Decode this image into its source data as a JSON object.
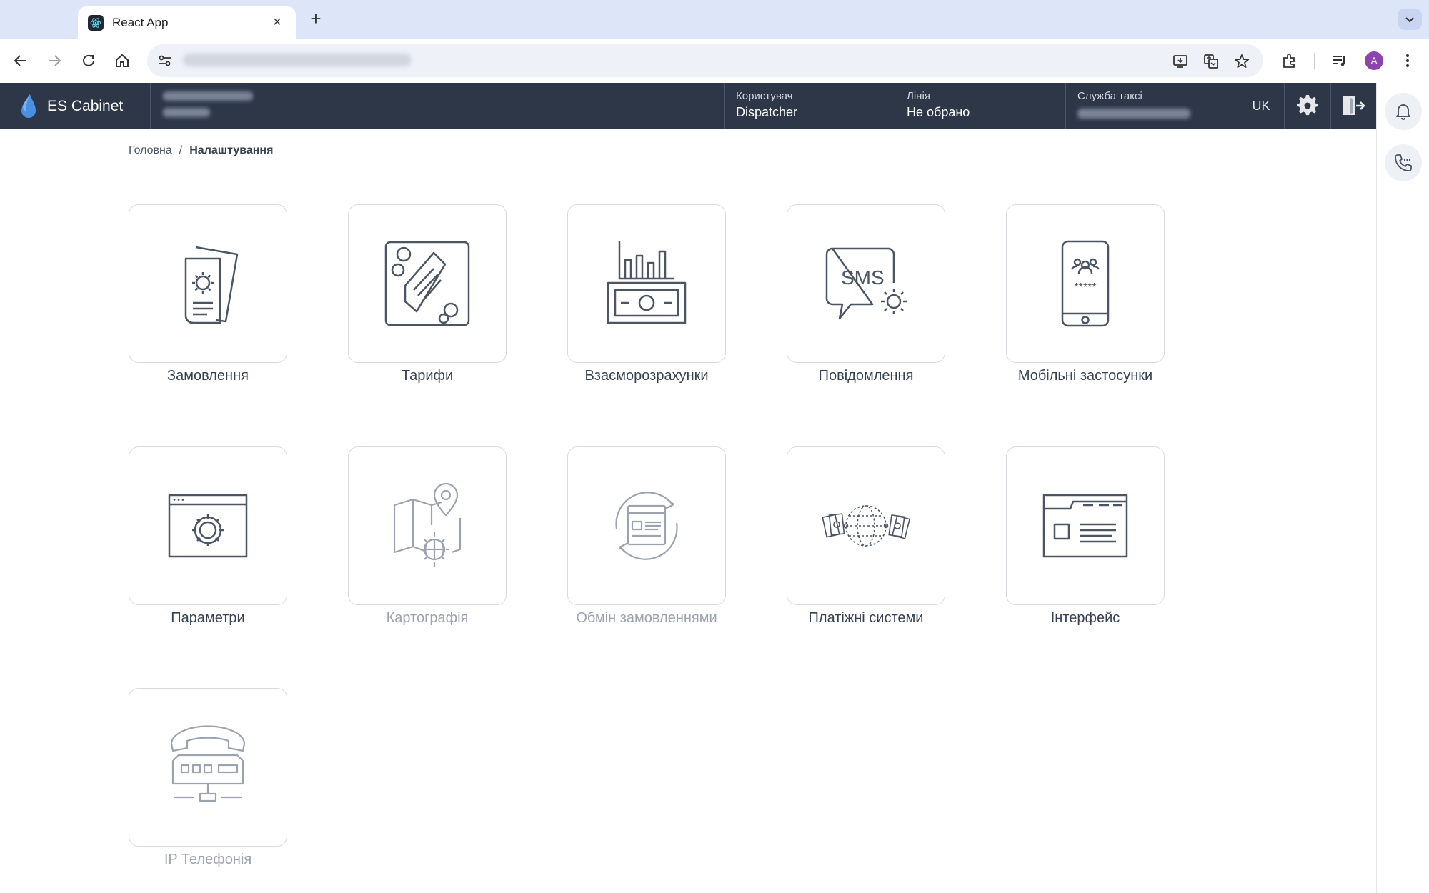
{
  "browser": {
    "tab_title": "React App",
    "close_glyph": "×",
    "new_tab_glyph": "+",
    "avatar_letter": "A"
  },
  "header": {
    "brand": "ES Cabinet",
    "user_label": "Користувач",
    "user_value": "Dispatcher",
    "line_label": "Лінія",
    "line_value": "Не обрано",
    "service_label": "Служба таксі",
    "language": "UK"
  },
  "breadcrumb": {
    "home": "Головна",
    "separator": "/",
    "current": "Налаштування"
  },
  "cards": [
    {
      "label": "Замовлення",
      "icon": "order-settings-icon",
      "enabled": true
    },
    {
      "label": "Тарифи",
      "icon": "tariff-ticket-icon",
      "enabled": true
    },
    {
      "label": "Взаєморозрахунки",
      "icon": "settlements-money-icon",
      "enabled": true
    },
    {
      "label": "Повідомлення",
      "icon": "sms-settings-icon",
      "enabled": true,
      "icon_text": "SMS"
    },
    {
      "label": "Мобільні застосунки",
      "icon": "mobile-app-icon",
      "enabled": true,
      "icon_text": "*****"
    },
    {
      "label": "Параметри",
      "icon": "parameters-window-icon",
      "enabled": true
    },
    {
      "label": "Картографія",
      "icon": "map-globe-icon",
      "enabled": false
    },
    {
      "label": "Обмін замовленнями",
      "icon": "order-exchange-icon",
      "enabled": false
    },
    {
      "label": "Платіжні системи",
      "icon": "payment-systems-icon",
      "enabled": true
    },
    {
      "label": "Інтерфейс",
      "icon": "interface-window-icon",
      "enabled": true
    },
    {
      "label": "IP Телефонія",
      "icon": "ip-phone-icon",
      "enabled": false
    }
  ],
  "colors": {
    "header_bg": "#2d3748",
    "brand_drop": "#4a90e2",
    "icon_stroke": "#4b5563",
    "icon_dim": "#9ca3af"
  }
}
